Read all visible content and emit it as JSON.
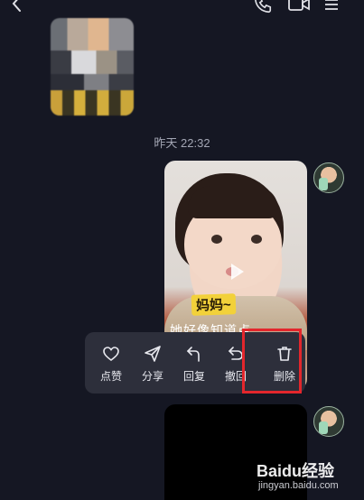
{
  "header": {
    "icons": [
      "back-icon",
      "phone-icon",
      "video-icon",
      "more-icon"
    ]
  },
  "chat": {
    "timestamp": "昨天 22:32",
    "video": {
      "caption": "妈妈~",
      "subtitle": "她好像知道点"
    }
  },
  "action_menu": {
    "items": [
      {
        "label": "点赞",
        "icon": "heart-icon"
      },
      {
        "label": "分享",
        "icon": "share-icon"
      },
      {
        "label": "回复",
        "icon": "reply-icon"
      },
      {
        "label": "撤回",
        "icon": "recall-icon"
      },
      {
        "label": "删除",
        "icon": "trash-icon"
      }
    ],
    "highlight_color": "#e3262c"
  },
  "watermark": {
    "brand": "Baidu经验",
    "url": "jingyan.baidu.com"
  }
}
